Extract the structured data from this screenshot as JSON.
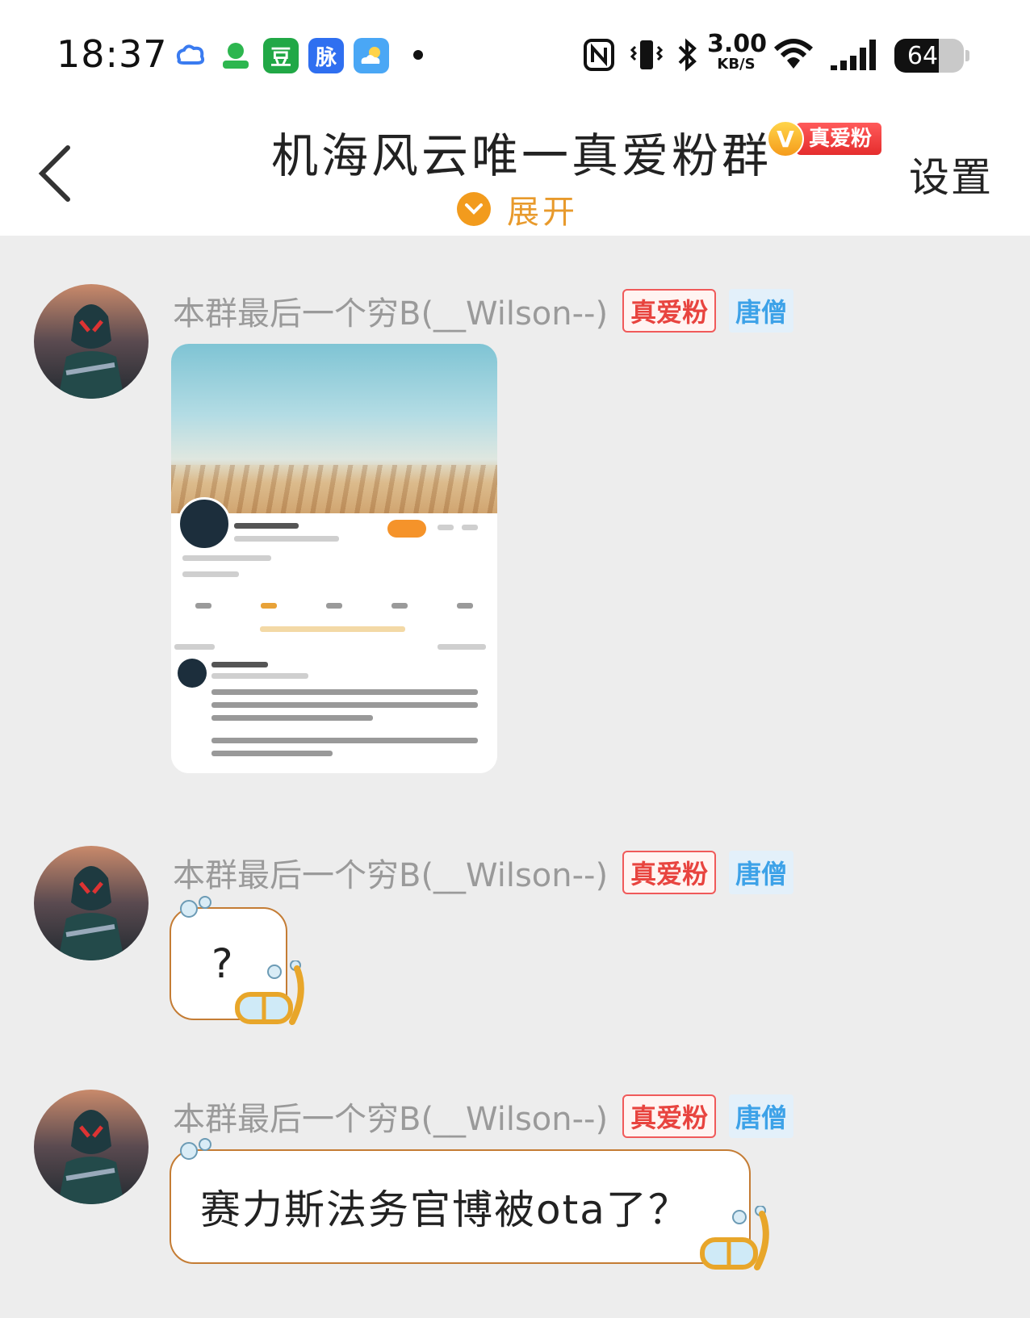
{
  "status_bar": {
    "time": "18:37",
    "network_speed_value": "3.00",
    "network_speed_unit": "KB/S",
    "battery_level": "64",
    "apps": [
      {
        "name": "baidu-netdisk-icon",
        "glyph": "☁",
        "color": "#3a7bf0"
      },
      {
        "name": "app-green-icon",
        "glyph": "✿",
        "color": "#2db64f"
      },
      {
        "name": "douban-icon",
        "glyph": "豆",
        "color": "#21a846"
      },
      {
        "name": "maimai-icon",
        "glyph": "脉",
        "color": "#2f6ff0"
      },
      {
        "name": "weather-icon",
        "glyph": "☀",
        "color": "#4aa7f5"
      }
    ]
  },
  "nav": {
    "title": "机海风云唯一真爱粉群",
    "fan_badge_letter": "V",
    "fan_badge_text": "真爱粉",
    "settings_label": "设置",
    "expand_label": "展开"
  },
  "messages": [
    {
      "sender": "本群最后一个穷B(__Wilson--)",
      "fan_tag": "真爱粉",
      "rank_tag": "唐僧",
      "type": "image"
    },
    {
      "sender": "本群最后一个穷B(__Wilson--)",
      "fan_tag": "真爱粉",
      "rank_tag": "唐僧",
      "type": "text",
      "text": "?"
    },
    {
      "sender": "本群最后一个穷B(__Wilson--)",
      "fan_tag": "真爱粉",
      "rank_tag": "唐僧",
      "type": "text",
      "text": "赛力斯法务官博被ota了？"
    }
  ],
  "colors": {
    "accent_orange": "#f29b1d",
    "fan_tag_red": "#e8443f",
    "rank_tag_blue": "#3da2e8",
    "bubble_border": "#c47c34",
    "chat_background": "#ededed"
  }
}
